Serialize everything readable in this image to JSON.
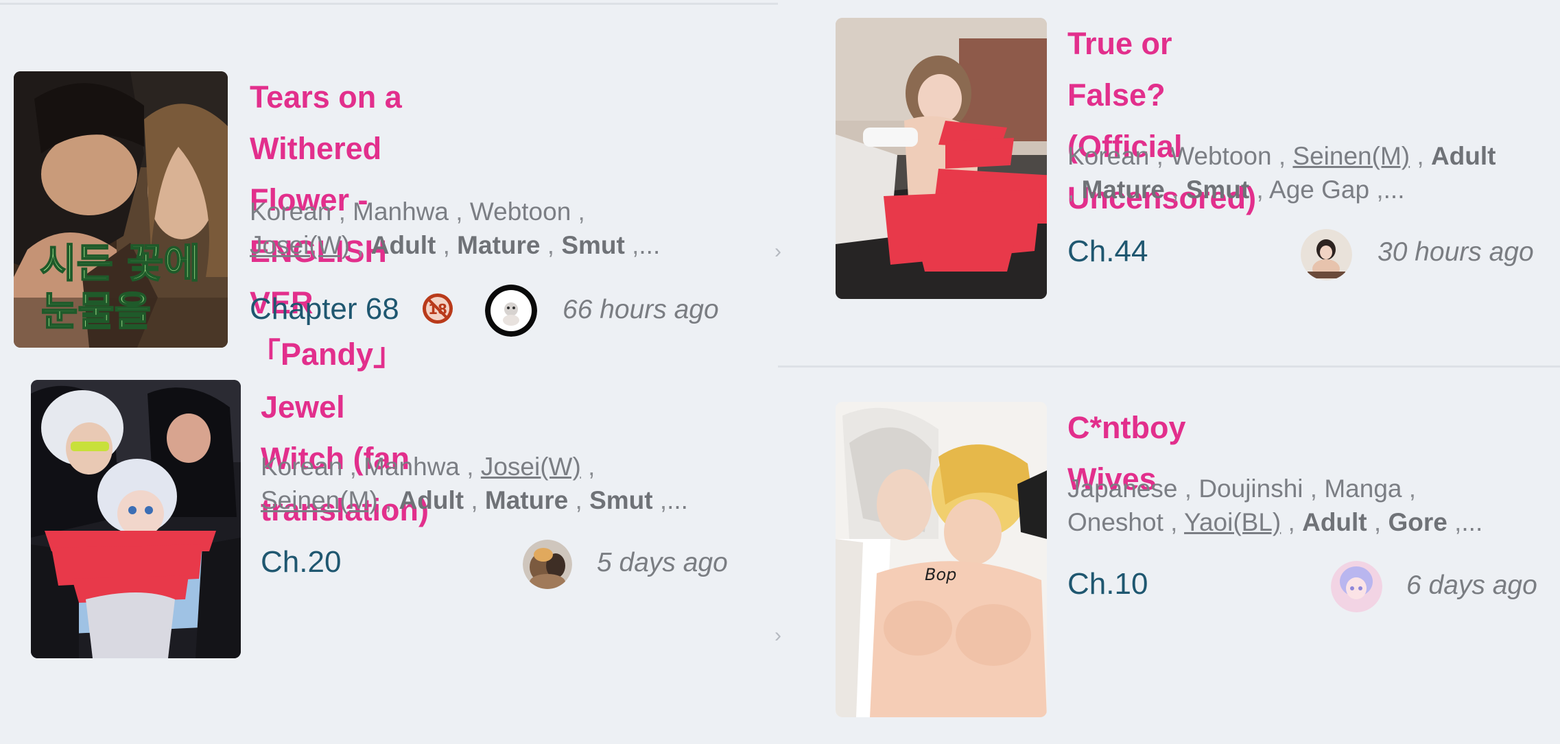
{
  "cards": [
    {
      "title_line1": "Tears on a Withered Flower -",
      "title_line2": "ENGLISH VER「Pandy」",
      "cover_text": "시든 꽃에 눈물을",
      "tags_line1": [
        "Korean",
        "Manhwa",
        "Webtoon"
      ],
      "tags_line2_u": "Josei(W)",
      "tags_line2_b": [
        "Adult",
        "Mature",
        "Smut"
      ],
      "chapter": "Chapter 68",
      "age_badge": "18",
      "time": "66 hours ago"
    },
    {
      "title_line1": "Jewel Witch (fan translation)",
      "tags_line1": [
        "Korean",
        "Manhwa"
      ],
      "tags_line1_u": "Josei(W)",
      "tags_line2_u": "Seinen(M)",
      "tags_line2_b": [
        "Adult",
        "Mature",
        "Smut"
      ],
      "chapter": "Ch.20",
      "time": "5 days ago"
    },
    {
      "title_line1": "True or False? (Official",
      "title_line2": "Uncensored)",
      "tags_line1": [
        "Korean",
        "Webtoon"
      ],
      "tags_line1_u": "Seinen(M)",
      "tags_line1_b": "Adult",
      "tags_line2_b": [
        "Mature",
        "Smut"
      ],
      "tags_line2_plain": "Age Gap",
      "chapter": "Ch.44",
      "time": "30 hours ago"
    },
    {
      "title_line1": "C*ntboy Wives",
      "tags_line1": [
        "Japanese",
        "Doujinshi",
        "Manga"
      ],
      "tags_line2_plain": "Oneshot",
      "tags_line2_u": "Yaoi(BL)",
      "tags_line2_b": [
        "Adult",
        "Gore"
      ],
      "cover_text": "Bop",
      "chapter": "Ch.10",
      "time": "6 days ago"
    }
  ],
  "ellipsis": "...",
  "edge_chevron": "›",
  "colors": {
    "background": "#edf0f4",
    "title": "#e22f8c",
    "chapter": "#1f5770",
    "tags": "#7b7e84",
    "censor": "#e8394a"
  }
}
